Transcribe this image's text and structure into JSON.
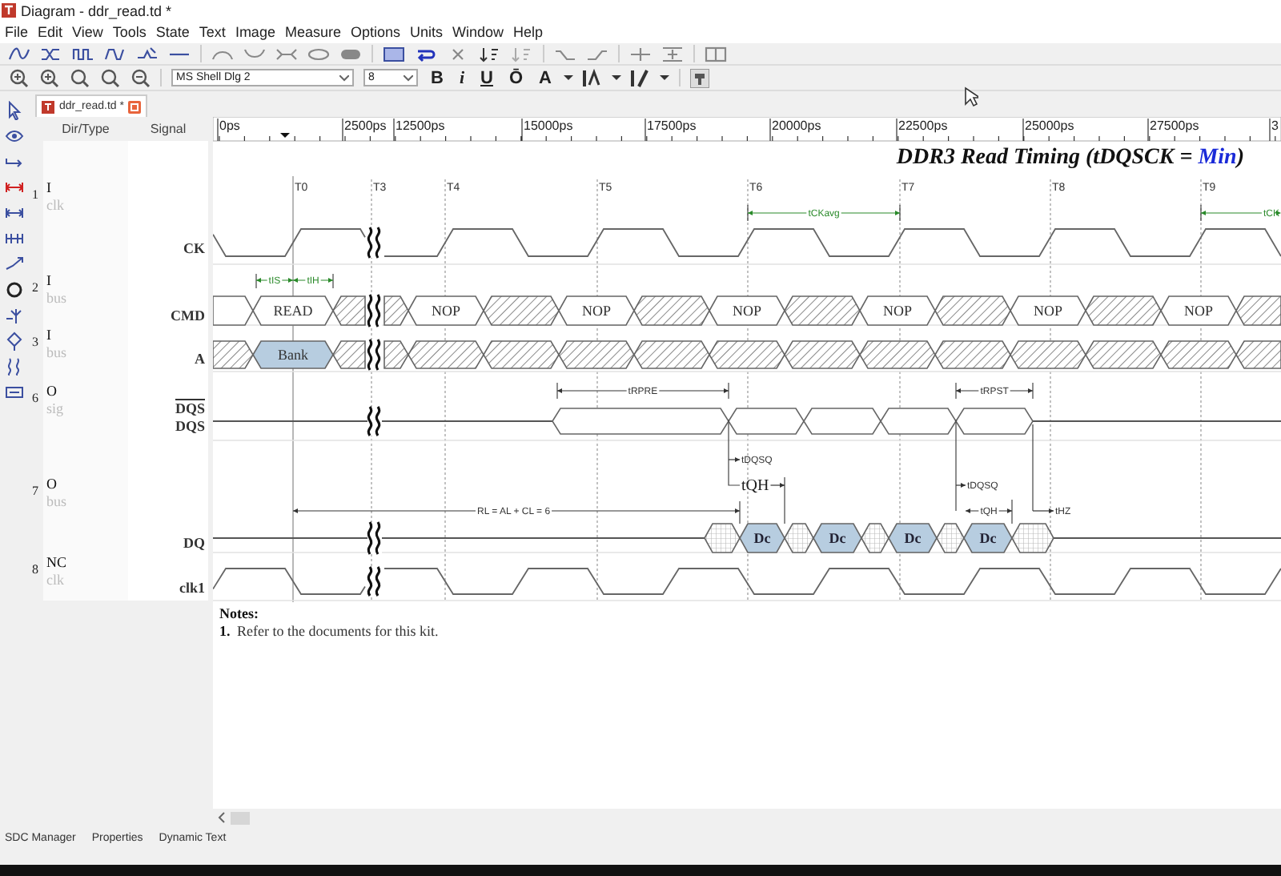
{
  "window": {
    "title": "Diagram - ddr_read.td *"
  },
  "menu": [
    "File",
    "Edit",
    "View",
    "Tools",
    "State",
    "Text",
    "Image",
    "Measure",
    "Options",
    "Units",
    "Window",
    "Help"
  ],
  "format_toolbar": {
    "font": "MS Shell Dlg 2",
    "size": "8",
    "styles": [
      "B",
      "i",
      "U",
      "Ō"
    ],
    "color_button": "A"
  },
  "tabs": [
    {
      "label": "ddr_read.td *",
      "selected": true
    }
  ],
  "signal_panel": {
    "columns": [
      "Dir/Type",
      "Signal"
    ]
  },
  "ruler": [
    "0ps",
    "2500ps",
    "12500ps",
    "15000ps",
    "17500ps",
    "20000ps",
    "22500ps",
    "25000ps",
    "27500ps",
    "3"
  ],
  "diagram_title": [
    {
      "kind": "plain",
      "text": "DDR3 Read Timing (tDQSCK = "
    },
    {
      "kind": "highlight",
      "text": "Min"
    },
    {
      "kind": "plain",
      "text": ")"
    }
  ],
  "edges": [
    "T0",
    "T3",
    "T4",
    "T5",
    "T6",
    "T7",
    "T8",
    "T9"
  ],
  "signals": [
    {
      "number": "1",
      "dir": "I",
      "type": "clk",
      "names": [
        {
          "text": "CK",
          "overline": false
        }
      ],
      "wave": {
        "kind": "clock",
        "inverted": false
      }
    },
    {
      "number": "2",
      "dir": "I",
      "type": "bus",
      "names": [
        {
          "text": "CMD",
          "overline": false
        }
      ],
      "wave": {
        "kind": "bus",
        "segments": [
          {
            "kind": "blank"
          },
          {
            "kind": "value",
            "text": "READ"
          },
          {
            "kind": "hatched"
          },
          {
            "kind": "hatched"
          },
          {
            "kind": "value",
            "text": "NOP"
          },
          {
            "kind": "hatched"
          },
          {
            "kind": "value",
            "text": "NOP"
          },
          {
            "kind": "hatched"
          },
          {
            "kind": "value",
            "text": "NOP"
          },
          {
            "kind": "hatched"
          },
          {
            "kind": "value",
            "text": "NOP"
          },
          {
            "kind": "hatched"
          },
          {
            "kind": "value",
            "text": "NOP"
          },
          {
            "kind": "hatched"
          },
          {
            "kind": "value",
            "text": "NOP"
          },
          {
            "kind": "hatched"
          }
        ]
      }
    },
    {
      "number": "3",
      "dir": "I",
      "type": "bus",
      "names": [
        {
          "text": "A",
          "overline": false
        }
      ],
      "wave": {
        "kind": "bus",
        "segments": [
          {
            "kind": "hatched"
          },
          {
            "kind": "filled",
            "text": "Bank"
          },
          {
            "kind": "hatched"
          },
          {
            "kind": "hatched"
          },
          {
            "kind": "hatched"
          },
          {
            "kind": "hatched"
          },
          {
            "kind": "hatched"
          },
          {
            "kind": "hatched"
          },
          {
            "kind": "hatched"
          },
          {
            "kind": "hatched"
          },
          {
            "kind": "hatched"
          },
          {
            "kind": "hatched"
          },
          {
            "kind": "hatched"
          },
          {
            "kind": "hatched"
          },
          {
            "kind": "hatched"
          },
          {
            "kind": "hatched"
          }
        ]
      }
    },
    {
      "number": "6",
      "dir": "O",
      "type": "sig",
      "names": [
        {
          "text": "DQS",
          "overline": true
        },
        {
          "text": "DQS",
          "overline": false
        }
      ],
      "wave": {
        "kind": "strobe",
        "segments": [
          {
            "kind": "line"
          },
          {
            "kind": "toggle"
          },
          {
            "kind": "toggle"
          },
          {
            "kind": "toggle"
          },
          {
            "kind": "toggle"
          },
          {
            "kind": "toggle"
          },
          {
            "kind": "line"
          }
        ]
      }
    },
    {
      "number": "7",
      "dir": "O",
      "type": "bus",
      "names": [
        {
          "text": "DQ",
          "overline": false
        }
      ],
      "wave": {
        "kind": "data",
        "segments": [
          {
            "kind": "line"
          },
          {
            "kind": "invalid"
          },
          {
            "kind": "filled",
            "text": "Dc"
          },
          {
            "kind": "invalid"
          },
          {
            "kind": "filled",
            "text": "Dc"
          },
          {
            "kind": "invalid"
          },
          {
            "kind": "filled",
            "text": "Dc"
          },
          {
            "kind": "invalid"
          },
          {
            "kind": "filled",
            "text": "Dc"
          },
          {
            "kind": "invalid"
          },
          {
            "kind": "line"
          }
        ]
      }
    },
    {
      "number": "8",
      "dir": "NC",
      "type": "clk",
      "names": [
        {
          "text": "clk1",
          "overline": false
        }
      ],
      "wave": {
        "kind": "clock",
        "inverted": true
      }
    }
  ],
  "timing_marks": [
    {
      "label": "tIS"
    },
    {
      "label": "tIH"
    },
    {
      "label": "tCKavg"
    },
    {
      "label": "tCK"
    },
    {
      "label": "tRPRE"
    },
    {
      "label": "tRPST"
    },
    {
      "label": "tDQSQ"
    },
    {
      "label": "tQH"
    },
    {
      "label": "RL = AL + CL = 6"
    },
    {
      "label": "tDQSQ"
    },
    {
      "label": "tQH"
    },
    {
      "label": "tHZ"
    }
  ],
  "notes": {
    "heading": "Notes:",
    "items": [
      {
        "number": "1.",
        "text": "Refer to the documents for this kit."
      }
    ]
  },
  "bottom_tabs": [
    {
      "label": "SDC Manager",
      "selected": false
    },
    {
      "label": "Properties",
      "selected": false
    },
    {
      "label": "Dynamic Text",
      "selected": false
    }
  ]
}
